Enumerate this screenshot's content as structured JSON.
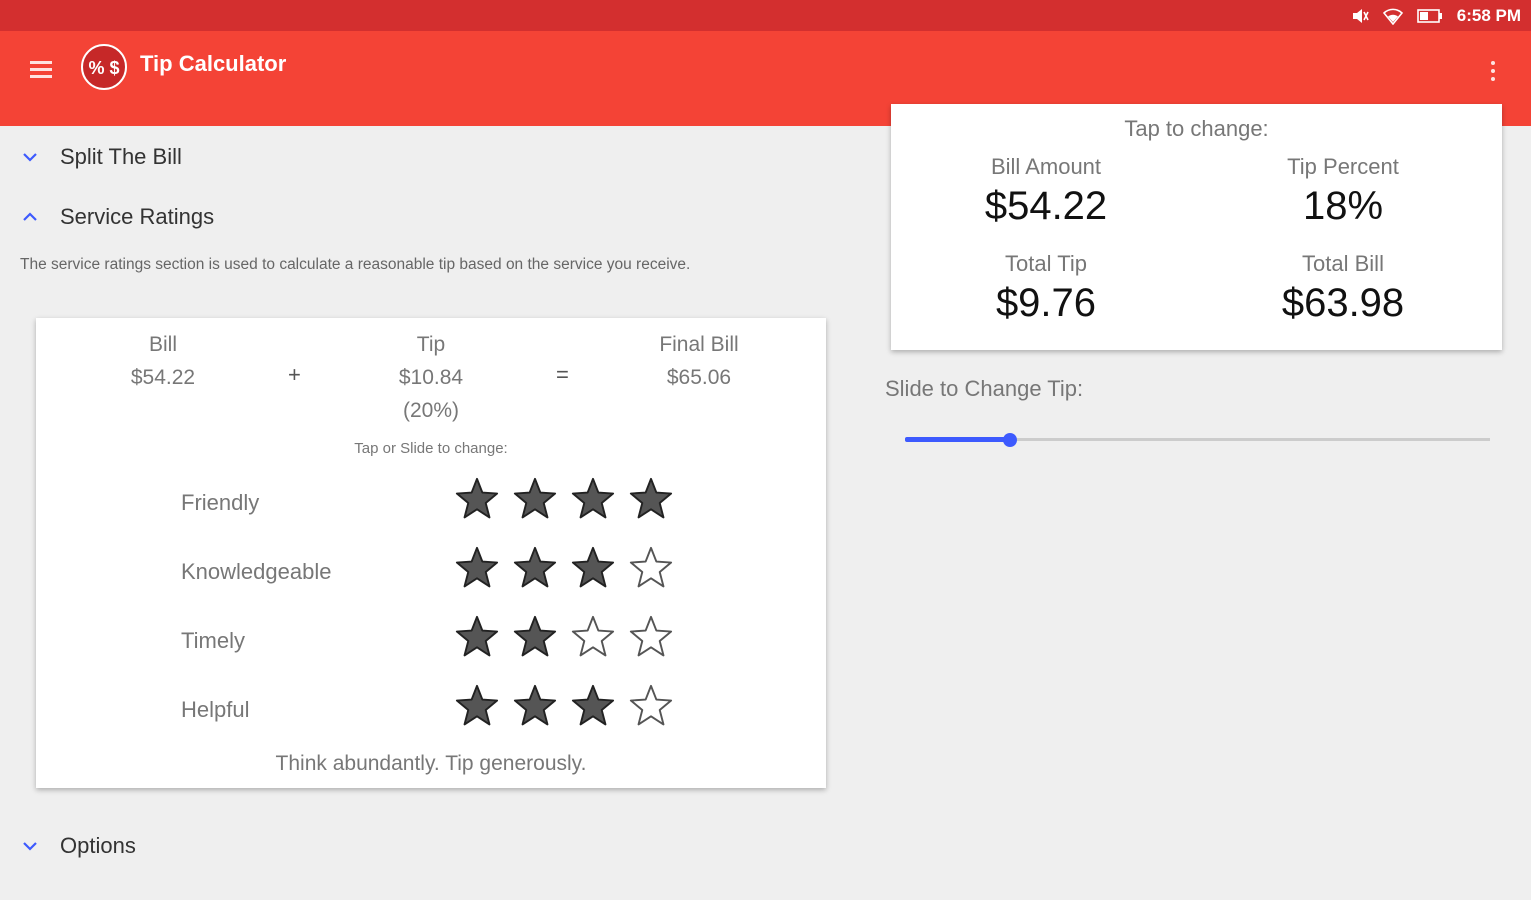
{
  "status_bar": {
    "time": "6:58 PM",
    "icons": [
      "mute-icon",
      "wifi-icon",
      "battery-icon"
    ]
  },
  "app_bar": {
    "title": "Tip Calculator",
    "logo_text": "% $"
  },
  "sections": {
    "split": {
      "label": "Split The Bill",
      "expanded": false
    },
    "ratings": {
      "label": "Service Ratings",
      "expanded": true,
      "description": "The service ratings section is used to calculate a reasonable tip based on the service you receive."
    },
    "options": {
      "label": "Options",
      "expanded": false
    }
  },
  "ratings_card": {
    "bill_label": "Bill",
    "bill_value": "$54.22",
    "plus": "+",
    "tip_label": "Tip",
    "tip_value": "$10.84",
    "tip_percent": "(20%)",
    "equals": "=",
    "final_label": "Final Bill",
    "final_value": "$65.06",
    "hint": "Tap or Slide to change:",
    "max_stars": 4,
    "rows": [
      {
        "label": "Friendly",
        "stars": 4
      },
      {
        "label": "Knowledgeable",
        "stars": 3
      },
      {
        "label": "Timely",
        "stars": 2
      },
      {
        "label": "Helpful",
        "stars": 3
      }
    ],
    "motto": "Think abundantly. Tip generously."
  },
  "summary_card": {
    "title": "Tap to change:",
    "bill_amount_label": "Bill Amount",
    "bill_amount_value": "$54.22",
    "tip_percent_label": "Tip Percent",
    "tip_percent_value": "18%",
    "total_tip_label": "Total Tip",
    "total_tip_value": "$9.76",
    "total_bill_label": "Total Bill",
    "total_bill_value": "$63.98"
  },
  "slider": {
    "label": "Slide to Change Tip:",
    "fraction": 0.18
  },
  "colors": {
    "status_bar": "#d32f2f",
    "app_bar": "#f44336",
    "accent": "#3d5afe",
    "background": "#efefef",
    "star_filled": "#555555"
  }
}
